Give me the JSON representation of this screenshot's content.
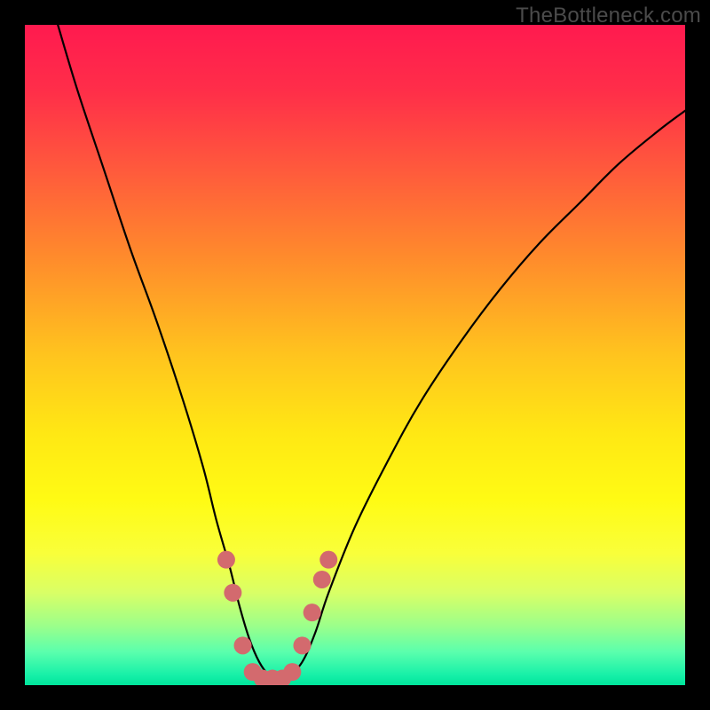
{
  "watermark": "TheBottleneck.com",
  "gradient": {
    "stops": [
      {
        "offset": 0.0,
        "color": "#ff1a4f"
      },
      {
        "offset": 0.1,
        "color": "#ff2e49"
      },
      {
        "offset": 0.22,
        "color": "#ff5a3c"
      },
      {
        "offset": 0.35,
        "color": "#ff8a2c"
      },
      {
        "offset": 0.5,
        "color": "#ffc41e"
      },
      {
        "offset": 0.62,
        "color": "#ffe814"
      },
      {
        "offset": 0.72,
        "color": "#fffb14"
      },
      {
        "offset": 0.8,
        "color": "#f9ff3a"
      },
      {
        "offset": 0.86,
        "color": "#d9ff66"
      },
      {
        "offset": 0.91,
        "color": "#9cff8a"
      },
      {
        "offset": 0.95,
        "color": "#5affad"
      },
      {
        "offset": 0.985,
        "color": "#16f0a8"
      },
      {
        "offset": 1.0,
        "color": "#00e59b"
      }
    ]
  },
  "chart_data": {
    "type": "line",
    "title": "",
    "xlabel": "",
    "ylabel": "",
    "xlim": [
      0,
      100
    ],
    "ylim": [
      0,
      100
    ],
    "x": [
      5,
      8,
      12,
      16,
      20,
      24,
      27,
      29,
      31,
      32.5,
      34,
      35.5,
      37,
      38.5,
      40,
      42,
      44,
      46,
      50,
      55,
      60,
      66,
      72,
      78,
      84,
      90,
      96,
      100
    ],
    "values": [
      100,
      90,
      78,
      66,
      55,
      43,
      33,
      25,
      18,
      12,
      7,
      3.5,
      1.5,
      1,
      1.5,
      3.5,
      8,
      14,
      24,
      34,
      43,
      52,
      60,
      67,
      73,
      79,
      84,
      87
    ],
    "annotations": {
      "valley_marker": {
        "color": "#d36a6e",
        "points_x": [
          30.5,
          31.5,
          33.0,
          34.5,
          36.0,
          37.5,
          39.0,
          40.5,
          42.0,
          43.5,
          45.0,
          46.0
        ],
        "points_y": [
          19.0,
          14.0,
          6.0,
          2.0,
          1.0,
          1.0,
          1.0,
          2.0,
          6.0,
          11.0,
          16.0,
          19.0
        ]
      }
    }
  }
}
